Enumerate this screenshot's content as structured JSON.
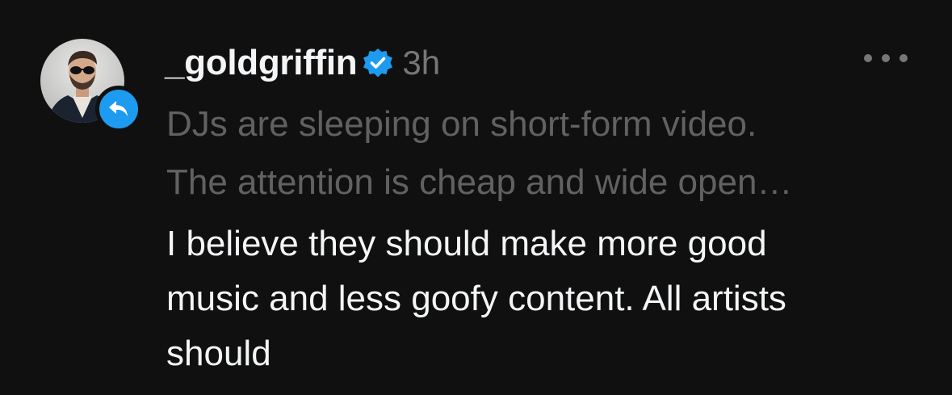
{
  "post": {
    "username": "_goldgriffin",
    "verified": true,
    "timestamp": "3h",
    "avatar_icon": "profile-photo",
    "badge_icon": "reply-arrow-icon",
    "more_icon": "more-horizontal-icon",
    "quoted_lines": [
      "DJs are sleeping on short-form video.",
      "The attention is cheap and wide open…"
    ],
    "reply_lines": [
      "I believe they should make more good",
      "music and less goofy content. All artists",
      "should"
    ]
  },
  "colors": {
    "background": "#101010",
    "primary_text": "#f3f5f7",
    "secondary_text": "#777777",
    "quoted_text": "#616161",
    "accent": "#1d9bf0"
  }
}
